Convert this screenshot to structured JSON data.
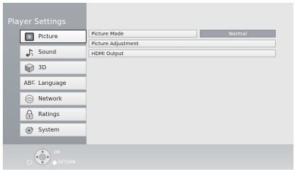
{
  "title": "Player Settings",
  "menu": [
    {
      "label": "Picture",
      "icon": "picture-icon",
      "selected": true
    },
    {
      "label": "Sound",
      "icon": "sound-icon"
    },
    {
      "label": "3D",
      "icon": "3d-cube-icon"
    },
    {
      "label": "Language",
      "icon": "abc-language-icon",
      "icon_text_a": "AB",
      "icon_text_b": "C"
    },
    {
      "label": "Network",
      "icon": "network-icon"
    },
    {
      "label": "Ratings",
      "icon": "lock-icon"
    },
    {
      "label": "System",
      "icon": "system-icon"
    }
  ],
  "settings": [
    {
      "label": "Picture Mode",
      "value": "Normal"
    },
    {
      "label": "Picture Adjustment"
    },
    {
      "label": "HDMI Output"
    }
  ],
  "footer": {
    "ok": "OK",
    "return": "RETURN"
  },
  "colors": {
    "sidebar": "#9ca1a6",
    "panel": "#e6e6e6",
    "value_box": "#9fa2a6",
    "selected_border": "#333333"
  }
}
